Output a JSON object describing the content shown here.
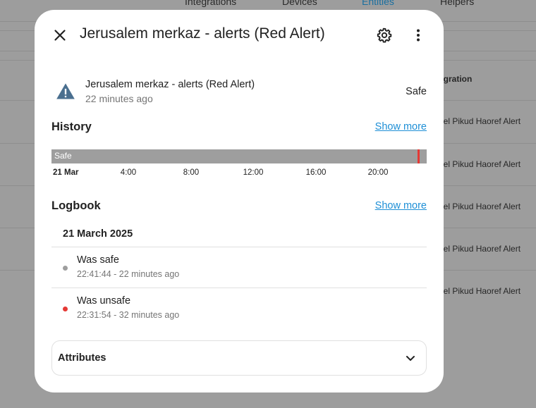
{
  "background": {
    "tabs": [
      "Integrations",
      "Devices",
      "Entities",
      "Helpers"
    ],
    "column_header": "egration",
    "rows": [
      "ael Pikud Haoref Alert",
      "ael Pikud Haoref Alert",
      "ael Pikud Haoref Alert",
      "ael Pikud Haoref Alert",
      "ael Pikud Haoref Alert"
    ]
  },
  "dialog": {
    "title": "Jerusalem merkaz - alerts (Red Alert)",
    "close_icon": "close-icon",
    "settings_icon": "gear-icon",
    "more_icon": "more-vertical-icon"
  },
  "entity": {
    "icon": "alert-triangle-icon",
    "name": "Jerusalem merkaz - alerts (Red Alert)",
    "time": "22 minutes ago",
    "state": "Safe"
  },
  "history": {
    "title": "History",
    "show_more": "Show more",
    "bar_label": "Safe",
    "ticks": [
      "21 Mar",
      "4:00",
      "8:00",
      "12:00",
      "16:00",
      "20:00"
    ]
  },
  "logbook": {
    "title": "Logbook",
    "show_more": "Show more",
    "date": "21 March 2025",
    "entries": [
      {
        "title": "Was safe",
        "subtitle": "22:41:44 - 22 minutes ago",
        "color": "#9e9e9e"
      },
      {
        "title": "Was unsafe",
        "subtitle": "22:31:54 - 32 minutes ago",
        "color": "#e53935"
      }
    ]
  },
  "attributes": {
    "label": "Attributes",
    "icon": "chevron-down-icon"
  },
  "colors": {
    "accent": "#1e8fd6",
    "alert_red": "#e53935",
    "safe_gray": "#9e9e9e",
    "warning_icon": "#4a6f8f"
  }
}
